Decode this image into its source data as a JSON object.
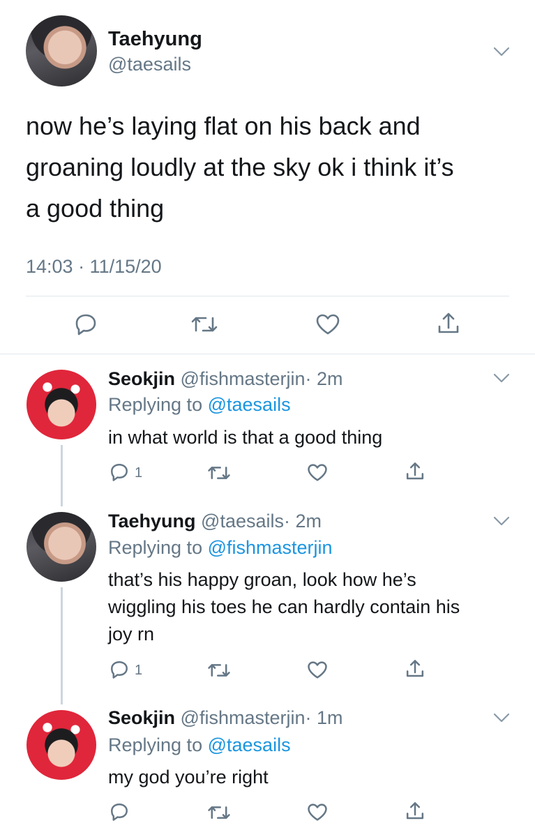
{
  "main_tweet": {
    "display_name": "Taehyung",
    "handle": "@taesails",
    "text_lines": [
      "now he’s laying flat on his back and",
      "groaning loudly at the sky ok i think it’s",
      "a good thing"
    ],
    "timestamp": "14:03 · 11/15/20",
    "icons": [
      "reply-icon",
      "retweet-icon",
      "like-icon",
      "share-icon"
    ]
  },
  "replies": [
    {
      "display_name": "Seokjin",
      "handle": "@fishmasterjin",
      "time": "· 2m",
      "replying_label": "Replying to",
      "replying_to": "@taesails",
      "text_lines": [
        "in what world is that a good thing"
      ],
      "reply_count": "1"
    },
    {
      "display_name": "Taehyung",
      "handle": "@taesails",
      "time": "· 2m",
      "replying_label": "Replying to",
      "replying_to": "@fishmasterjin",
      "text_lines": [
        "that’s his happy groan, look how he’s",
        "wiggling his toes he can hardly contain his",
        "joy rn"
      ],
      "reply_count": "1"
    },
    {
      "display_name": "Seokjin",
      "handle": "@fishmasterjin",
      "time": "· 1m",
      "replying_label": "Replying to",
      "replying_to": "@taesails",
      "text_lines": [
        "my god you’re right"
      ],
      "reply_count": ""
    }
  ],
  "colors": {
    "text": "#14171a",
    "muted": "#657786",
    "link": "#1b95e0",
    "divider": "#e1e8ed"
  }
}
